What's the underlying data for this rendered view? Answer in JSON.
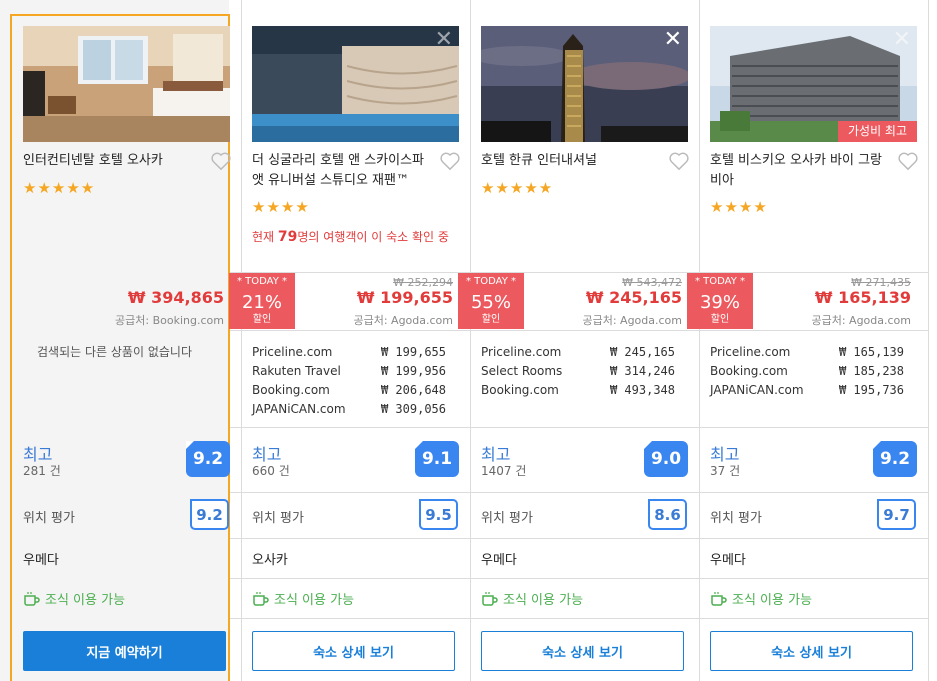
{
  "hotels": [
    {
      "name": "인터컨티넨탈 호텔 오사카",
      "stars": "★★★★★",
      "price": "₩ 394,865",
      "supplier": "공급처: Booking.com",
      "no_offers_text": "검색되는 다른 상품이 없습니다",
      "rating_label": "최고",
      "review_count": "281 건",
      "score": "9.2",
      "location_label": "위치 평가",
      "location_score": "9.2",
      "area": "우메다",
      "breakfast": "조식 이용 가능",
      "button": "지금 예약하기"
    },
    {
      "name": "더 싱굴라리 호텔 앤 스카이스파 앳 유니버설 스튜디오 재팬™",
      "stars": "★★★★",
      "promo_prefix": "현재 ",
      "promo_count": "79",
      "promo_suffix": "명의 여행객이 이 숙소 확인 중",
      "today_label": "* TODAY *",
      "discount": "21%",
      "discount_label": "할인",
      "old_price": "₩ 252,294",
      "price": "₩ 199,655",
      "supplier": "공급처: Agoda.com",
      "offers": [
        {
          "site": "Priceline.com",
          "price": "₩ 199,655"
        },
        {
          "site": "Rakuten Travel",
          "price": "₩ 199,956"
        },
        {
          "site": "Booking.com",
          "price": "₩ 206,648"
        },
        {
          "site": "JAPANiCAN.com",
          "price": "₩ 309,056"
        }
      ],
      "rating_label": "최고",
      "review_count": "660 건",
      "score": "9.1",
      "location_label": "위치 평가",
      "location_score": "9.5",
      "area": "오사카",
      "breakfast": "조식 이용 가능",
      "button": "숙소 상세 보기"
    },
    {
      "name": "호텔 한큐 인터내셔널",
      "stars": "★★★★★",
      "today_label": "* TODAY *",
      "discount": "55%",
      "discount_label": "할인",
      "old_price": "₩ 543,472",
      "price": "₩ 245,165",
      "supplier": "공급처: Agoda.com",
      "offers": [
        {
          "site": "Priceline.com",
          "price": "₩ 245,165"
        },
        {
          "site": "Select Rooms",
          "price": "₩ 314,246"
        },
        {
          "site": "Booking.com",
          "price": "₩ 493,348"
        }
      ],
      "rating_label": "최고",
      "review_count": "1407 건",
      "score": "9.0",
      "location_label": "위치 평가",
      "location_score": "8.6",
      "area": "우메다",
      "breakfast": "조식 이용 가능",
      "button": "숙소 상세 보기"
    },
    {
      "name": "호텔 비스키오 오사카 바이 그랑비아",
      "stars": "★★★★",
      "badge": "가성비 최고",
      "today_label": "* TODAY *",
      "discount": "39%",
      "discount_label": "할인",
      "old_price": "₩ 271,435",
      "price": "₩ 165,139",
      "supplier": "공급처: Agoda.com",
      "offers": [
        {
          "site": "Priceline.com",
          "price": "₩ 165,139"
        },
        {
          "site": "Booking.com",
          "price": "₩ 185,238"
        },
        {
          "site": "JAPANiCAN.com",
          "price": "₩ 195,736"
        }
      ],
      "rating_label": "최고",
      "review_count": "37 건",
      "score": "9.2",
      "location_label": "위치 평가",
      "location_score": "9.7",
      "area": "우메다",
      "breakfast": "조식 이용 가능",
      "button": "숙소 상세 보기"
    }
  ],
  "colors": {
    "accent": "#1a7fd8",
    "discount": "#ec5a5f",
    "price": "#e23b3b",
    "score": "#3a86f0",
    "breakfast": "#4caf50",
    "selected_border": "#f5a623"
  }
}
